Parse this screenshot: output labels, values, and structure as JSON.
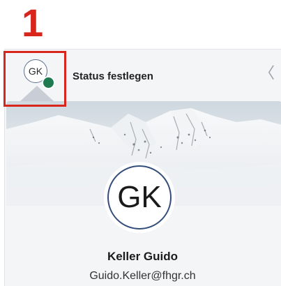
{
  "annotation": {
    "step_number": "1",
    "highlight_color": "#d9261c"
  },
  "header": {
    "avatar_initials": "GK",
    "presence_color": "#1e7a4f",
    "status_label": "Status festlegen",
    "collapse_icon": "chevron-left-icon",
    "collapse_glyph": "〈"
  },
  "profile": {
    "initials": "GK",
    "name": "Keller Guido",
    "email": "Guido.Keller@fhgr.ch"
  }
}
